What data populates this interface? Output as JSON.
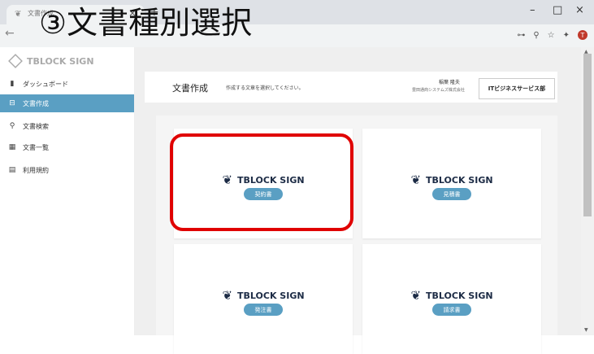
{
  "browser": {
    "tab_title": "文書作成",
    "tab_close": "×",
    "new_tab": "+",
    "favicon": "❦",
    "back": "←",
    "window_minimize": "–",
    "window_maximize": "□",
    "window_close": "×",
    "toolbar_icons": [
      "⊶",
      "⚲",
      "☆",
      "✦"
    ],
    "avatar_letter": "T"
  },
  "annotation": "③文書種別選択",
  "sidebar": {
    "logo": "TBLOCK SIGN",
    "items": [
      {
        "icon": "bar-chart-icon",
        "glyph": "▮",
        "label": "ダッシュボード",
        "active": false
      },
      {
        "icon": "document-icon",
        "glyph": "⊟",
        "label": "文書作成",
        "active": true
      },
      {
        "icon": "search-icon",
        "glyph": "⚲",
        "label": "文書検索",
        "active": false
      },
      {
        "icon": "list-icon",
        "glyph": "▦",
        "label": "文書一覧",
        "active": false
      },
      {
        "icon": "file-icon",
        "glyph": "▤",
        "label": "利用規約",
        "active": false
      }
    ]
  },
  "header": {
    "title": "文書作成",
    "subtitle": "作成する文章を選択してください。",
    "user_name": "稲葉 隆夫",
    "user_company": "豊田通商システムズ株式会社",
    "department": "ITビジネスサービス部"
  },
  "documents": [
    {
      "logo": "TBLOCK SIGN",
      "label": "契約書"
    },
    {
      "logo": "TBLOCK SIGN",
      "label": "見積書"
    },
    {
      "logo": "TBLOCK SIGN",
      "label": "発注書"
    },
    {
      "logo": "TBLOCK SIGN",
      "label": "請求書"
    }
  ],
  "colors": {
    "accent": "#5a9fc3",
    "highlight": "#e00000",
    "brand_dark": "#1c2b45"
  }
}
